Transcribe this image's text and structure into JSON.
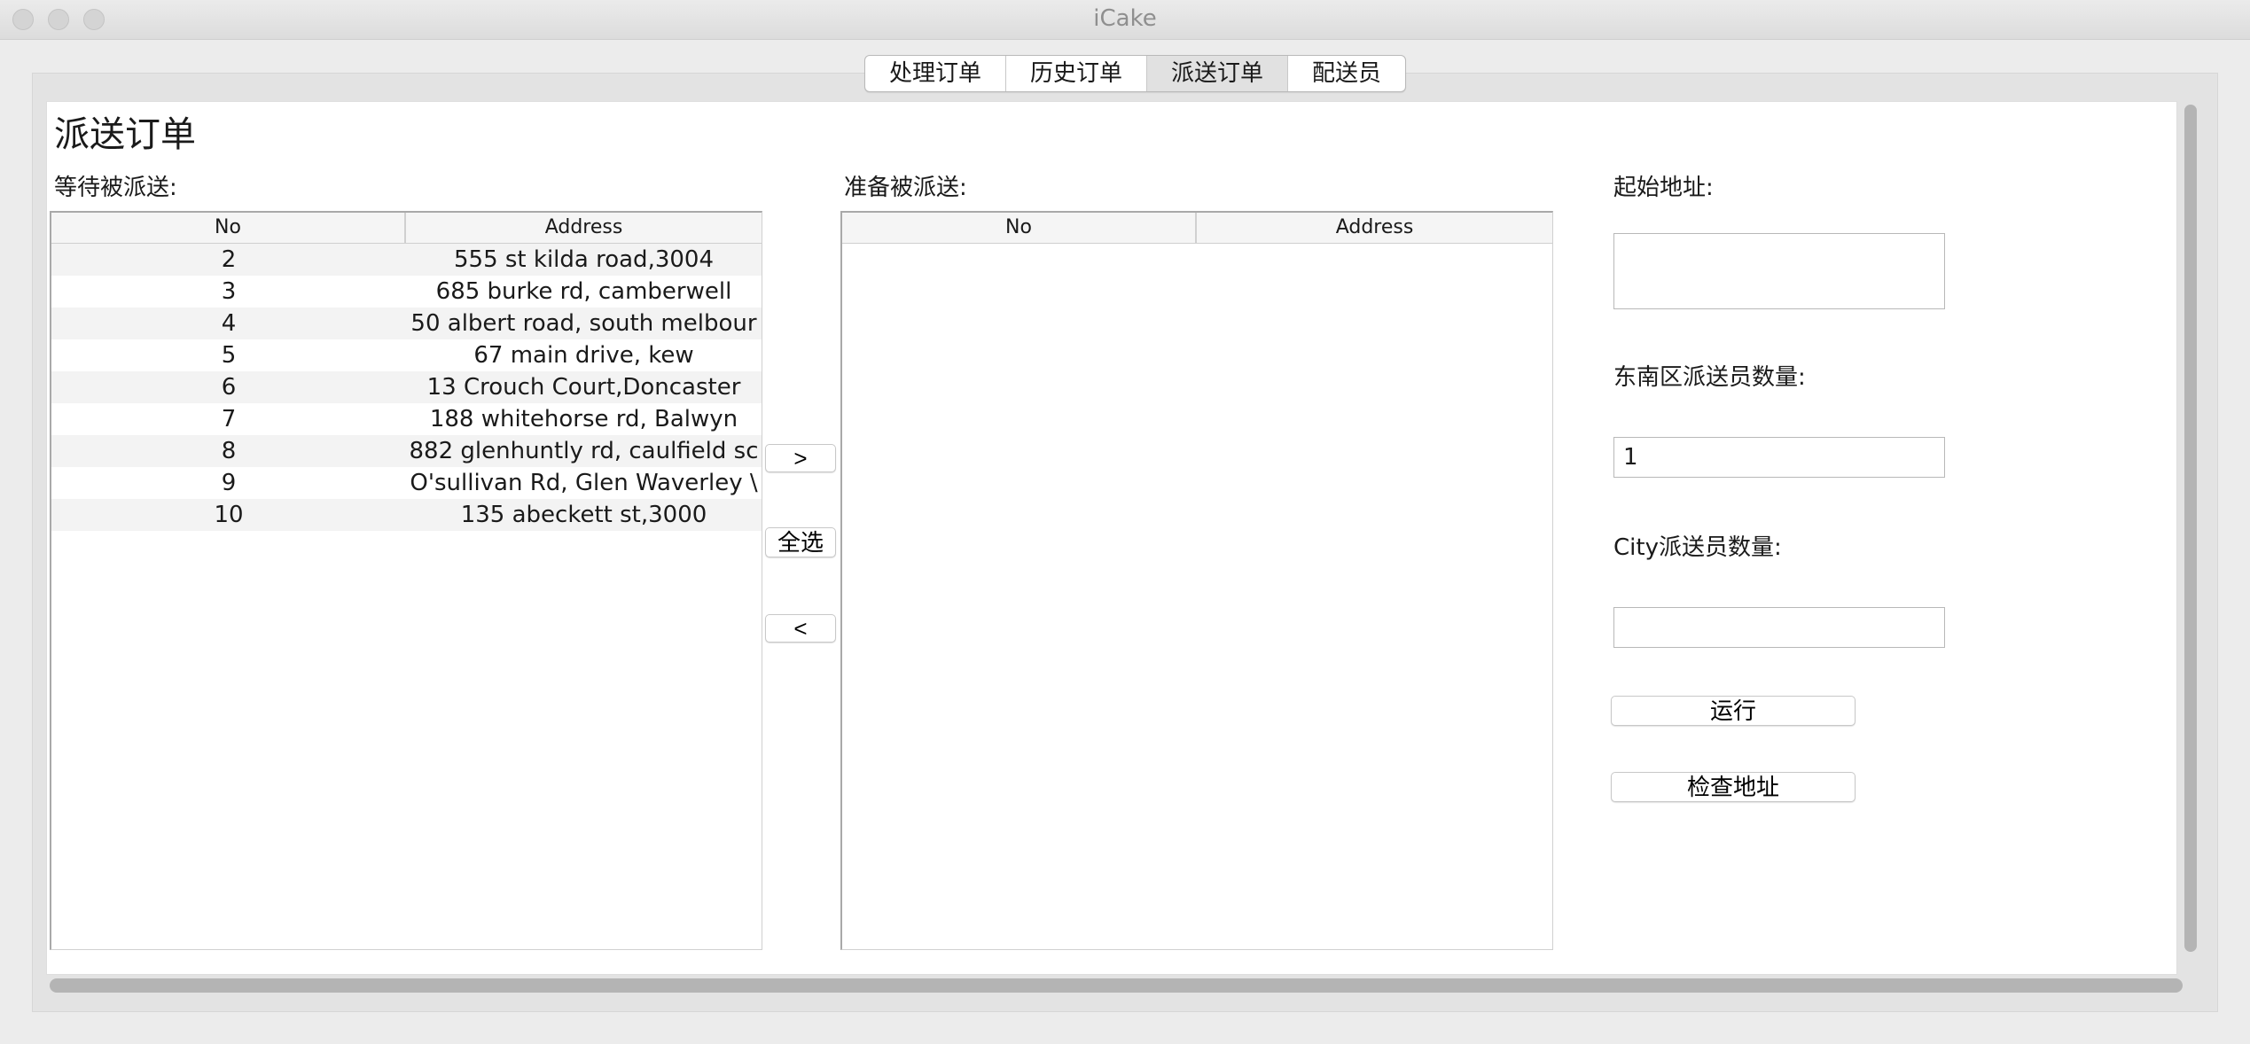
{
  "window": {
    "title": "iCake"
  },
  "tabs": [
    {
      "label": "处理订单",
      "active": false
    },
    {
      "label": "历史订单",
      "active": false
    },
    {
      "label": "派送订单",
      "active": true
    },
    {
      "label": "配送员",
      "active": false
    }
  ],
  "page": {
    "title": "派送订单"
  },
  "waiting": {
    "label": "等待被派送:",
    "columns": [
      "No",
      "Address"
    ],
    "rows": [
      {
        "no": "2",
        "address": "555 st kilda road,3004"
      },
      {
        "no": "3",
        "address": "685 burke rd, camberwell"
      },
      {
        "no": "4",
        "address": "50 albert road, south melbour"
      },
      {
        "no": "5",
        "address": "67 main drive, kew"
      },
      {
        "no": "6",
        "address": "13 Crouch Court,Doncaster"
      },
      {
        "no": "7",
        "address": "188 whitehorse rd, Balwyn"
      },
      {
        "no": "8",
        "address": "882 glenhuntly rd, caulfield sc"
      },
      {
        "no": "9",
        "address": "O'sullivan Rd, Glen Waverley \\"
      },
      {
        "no": "10",
        "address": "135 abeckett st,3000"
      }
    ]
  },
  "ready": {
    "label": "准备被派送:",
    "columns": [
      "No",
      "Address"
    ],
    "rows": []
  },
  "transfer": {
    "add_label": ">",
    "select_all_label": "全选",
    "remove_label": "<"
  },
  "settings": {
    "start_address_label": "起始地址:",
    "start_address_value": "",
    "southeast_count_label": "东南区派送员数量:",
    "southeast_count_value": "1",
    "city_count_label": "City派送员数量:",
    "city_count_value": "",
    "run_label": "运行",
    "check_address_label": "检查地址"
  }
}
